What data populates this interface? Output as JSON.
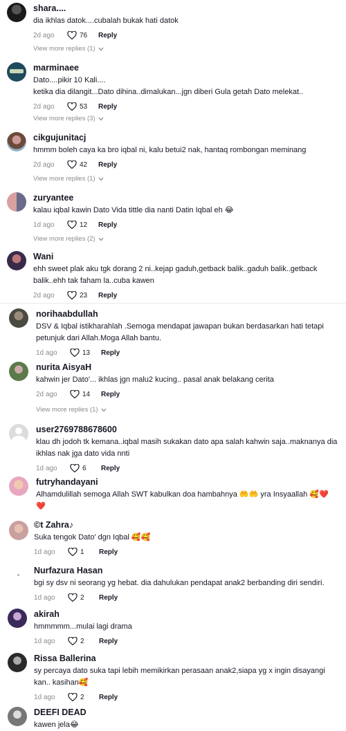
{
  "comments": [
    {
      "user": "shara....",
      "text": "dia ikhlas datok....cubalah bukak hati datok",
      "age": "2d ago",
      "likes": "76",
      "reply": "Reply",
      "more": "View more replies (1)"
    },
    {
      "user": "marminaee",
      "text": "Dato....pikir 10 Kali....\nketika dia dilangit...Dato dihina..dimalukan...jgn diberi Gula getah Dato melekat..",
      "age": "2d ago",
      "likes": "53",
      "reply": "Reply",
      "more": "View more replies (3)"
    },
    {
      "user": "cikgujunitacj",
      "text": "hmmm boleh caya ka bro iqbal ni, kalu betui2 nak, hantaq rombongan meminang",
      "age": "2d ago",
      "likes": "42",
      "reply": "Reply",
      "more": "View more replies (1)"
    },
    {
      "user": "zuryantee",
      "text": "kalau iqbal kawin Dato Vida tittle dia nanti Datin Iqbal eh 😂",
      "age": "1d ago",
      "likes": "12",
      "reply": "Reply",
      "more": "View more replies (2)"
    },
    {
      "user": "Wani",
      "text": "ehh sweet plak aku tgk dorang 2 ni..kejap gaduh,getback balik..gaduh balik..getback balik..ehh tak faham la..cuba kawen",
      "age": "2d ago",
      "likes": "23",
      "reply": "Reply"
    },
    {
      "user": "norihaabdullah",
      "text": "DSV & Iqbal istikharahlah .Semoga mendapat jawapan bukan berdasarkan hati tetapi petunjuk dari Allah.Moga Allah bantu.",
      "age": "1d ago",
      "likes": "13",
      "reply": "Reply"
    },
    {
      "user": "nurita AisyaH",
      "text": "kahwin jer Dato'... ikhlas jgn malu2 kucing.. pasal anak belakang cerita",
      "age": "2d ago",
      "likes": "14",
      "reply": "Reply",
      "more": "View more replies (1)"
    },
    {
      "user": "user2769788678600",
      "text": "klau dh jodoh tk kemana..iqbal masih sukakan dato apa salah kahwin saja..maknanya dia ikhlas nak jga dato vida nnti",
      "age": "1d ago",
      "likes": "6",
      "reply": "Reply"
    },
    {
      "user": "futryhandayani",
      "text": "Alhamdulillah semoga Allah SWT kabulkan doa hambahnya 🤲🤲 yra Insyaallah 🥰❤️❤️",
      "age": "",
      "likes": "",
      "reply": ""
    },
    {
      "user": "©t Zahra♪",
      "text": "Suka tengok Dato' dgn Iqbal 🥰🥰",
      "age": "1d ago",
      "likes": "1",
      "reply": "Reply"
    },
    {
      "user": "Nurfazura Hasan",
      "text": "bgi sy dsv ni seorang yg hebat. dia dahulukan pendapat anak2 berbanding diri sendiri.",
      "age": "1d ago",
      "likes": "2",
      "reply": "Reply"
    },
    {
      "user": "akirah",
      "text": "hmmmmm...mulai lagi drama",
      "age": "1d ago",
      "likes": "2",
      "reply": "Reply"
    },
    {
      "user": "Rissa Ballerina",
      "text": "sy percaya dato suka tapi lebih memikirkan perasaan anak2,siapa yg x ingin disayangi kan.. kasihan🥰",
      "age": "1d ago",
      "likes": "2",
      "reply": "Reply"
    },
    {
      "user": "DEEFI DEAD",
      "text": "kawen jela😂",
      "age": "",
      "likes": "",
      "reply": ""
    }
  ],
  "colors": {
    "text": "#161823",
    "muted": "#8a8b91",
    "divider": "#e9e9ec"
  }
}
